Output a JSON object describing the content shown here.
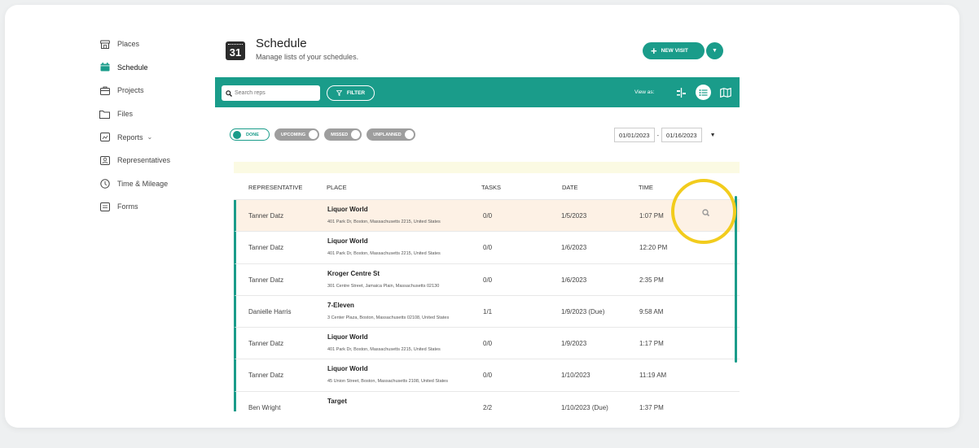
{
  "sidebar": {
    "items": [
      {
        "label": "Places",
        "icon": "store-icon"
      },
      {
        "label": "Schedule",
        "icon": "calendar-icon"
      },
      {
        "label": "Projects",
        "icon": "briefcase-icon"
      },
      {
        "label": "Files",
        "icon": "folder-icon"
      },
      {
        "label": "Reports",
        "icon": "chart-icon"
      },
      {
        "label": "Representatives",
        "icon": "person-icon"
      },
      {
        "label": "Time & Mileage",
        "icon": "clock-icon"
      },
      {
        "label": "Forms",
        "icon": "form-icon"
      }
    ]
  },
  "header": {
    "calendar_day": "31",
    "title": "Schedule",
    "subtitle": "Manage lists of your schedules.",
    "new_visit_label": "NEW VISIT"
  },
  "toolbar": {
    "search_placeholder": "Search reps",
    "filter_label": "FILTER",
    "view_as_label": "View as:"
  },
  "status_filters": [
    {
      "label": "DONE",
      "on": true
    },
    {
      "label": "UPCOMING",
      "on": false
    },
    {
      "label": "MISSED",
      "on": false
    },
    {
      "label": "UNPLANNED",
      "on": false
    }
  ],
  "date_range": {
    "start": "01/01/2023",
    "separator": "-",
    "end": "01/16/2023"
  },
  "table": {
    "columns": [
      "REPRESENTATIVE",
      "PLACE",
      "TASKS",
      "DATE",
      "TIME"
    ],
    "rows": [
      {
        "rep": "Tanner Datz",
        "place": "Liquor World",
        "address": "401 Park Dr, Boston, Massachusetts 2215, United States",
        "tasks": "0/0",
        "date": "1/5/2023",
        "time": "1:07 PM"
      },
      {
        "rep": "Tanner Datz",
        "place": "Liquor World",
        "address": "401 Park Dr, Boston, Massachusetts 2215, United States",
        "tasks": "0/0",
        "date": "1/6/2023",
        "time": "12:20 PM"
      },
      {
        "rep": "Tanner Datz",
        "place": "Kroger Centre St",
        "address": "301 Centre Street, Jamaica Plain, Massachusetts 02130",
        "tasks": "0/0",
        "date": "1/6/2023",
        "time": "2:35 PM"
      },
      {
        "rep": "Danielle Harris",
        "place": "7-Eleven",
        "address": "3 Center Plaza, Boston, Massachusetts 02108, United States",
        "tasks": "1/1",
        "date": "1/9/2023 (Due)",
        "time": "9:58 AM"
      },
      {
        "rep": "Tanner Datz",
        "place": "Liquor World",
        "address": "401 Park Dr, Boston, Massachusetts 2215, United States",
        "tasks": "0/0",
        "date": "1/9/2023",
        "time": "1:17 PM"
      },
      {
        "rep": "Tanner Datz",
        "place": "Liquor World",
        "address": "45 Union Street, Boston, Massachusetts 2108, United States",
        "tasks": "0/0",
        "date": "1/10/2023",
        "time": "11:19 AM"
      },
      {
        "rep": "Ben Wright",
        "place": "Target",
        "address": "",
        "tasks": "2/2",
        "date": "1/10/2023 (Due)",
        "time": "1:37 PM"
      }
    ]
  },
  "colors": {
    "accent": "#1a9c8a",
    "highlight_ring": "#f2cc1d",
    "row_highlight": "#fdf1e5"
  }
}
